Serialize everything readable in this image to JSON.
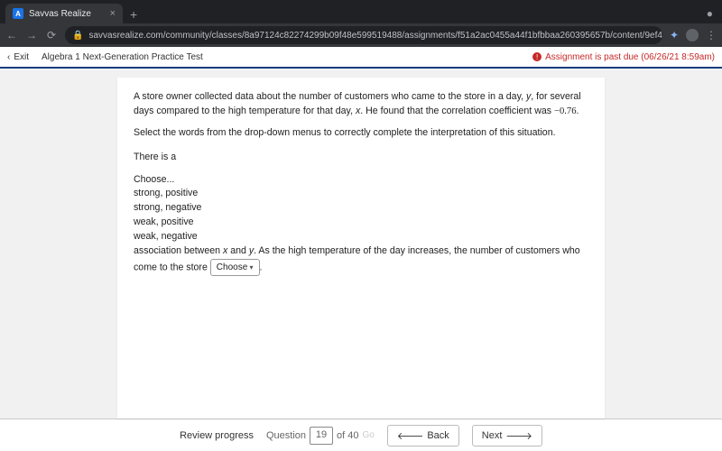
{
  "browser": {
    "tab_title": "Savvas Realize",
    "url": "savvasrealize.com/community/classes/8a97124c82274299b09f48e599519488/assignments/f51a2ac0455a44f1bfbbaa260395657b/content/9ef477e2-fc2e-3a98-81c..."
  },
  "appbar": {
    "exit": "Exit",
    "title": "Algebra 1 Next-Generation Practice Test",
    "due": "Assignment is past due (06/26/21 8:59am)"
  },
  "question": {
    "p1a": "A store owner collected data about the number of customers who came to the store in a day, ",
    "p1_y": "y",
    "p1b": ", for several days compared to the high temperature for that day, ",
    "p1_x": "x",
    "p1c": ". He found that the correlation coefficient was ",
    "coef": "−0.76",
    "p1d": ".",
    "p2": "Select the words from the drop-down menus to correctly complete the interpretation of this situation.",
    "s_a": "There is a ",
    "s_b": " association between ",
    "s_x": "x",
    "s_and": " and ",
    "s_y": "y",
    "s_c": ". As the high temperature of the day increases, the number of customers who come to the store ",
    "dd2_label": "Choose",
    "dropdown1": {
      "options": [
        "Choose...",
        "strong, positive",
        "strong, negative",
        "weak, positive",
        "weak, negative"
      ],
      "selected_index": 0
    }
  },
  "footer": {
    "review": "Review progress",
    "q_label": "Question",
    "q_current": "19",
    "q_of": "of 40",
    "go": "Go",
    "back": "Back",
    "next": "Next"
  }
}
